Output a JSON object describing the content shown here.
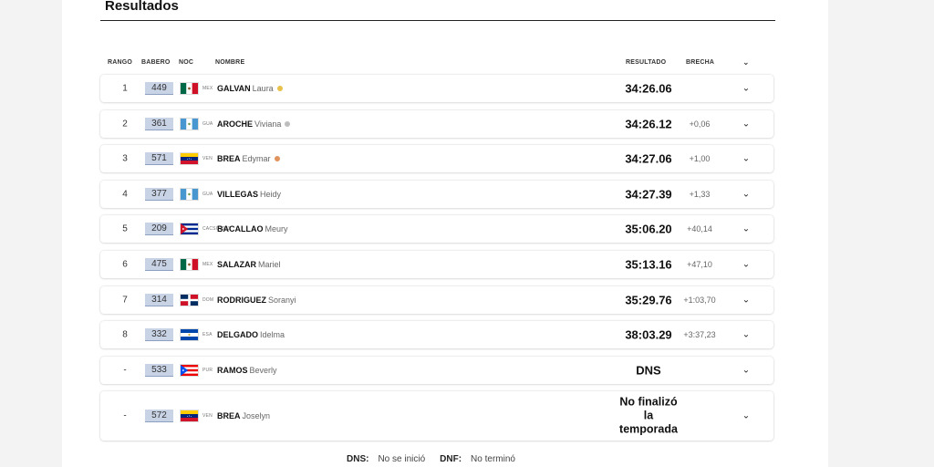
{
  "section": {
    "title": "Resultados"
  },
  "headers": {
    "rank": "RANGO",
    "bib": "BABERO",
    "noc": "NOC",
    "name": "NOMBRE",
    "result": "RESULTADO",
    "gap": "BRECHA",
    "expand": "⌄"
  },
  "colors": {
    "bib_bg": "#c9d3e6",
    "gold": "#e8c14b",
    "silver": "#bdbdbd",
    "bronze": "#e0935c"
  },
  "rows": [
    {
      "rank": "1",
      "bib": "449",
      "flag": "mexico-flag",
      "noc": "MEX",
      "last": "GALVAN",
      "first": "Laura",
      "medal": "gold",
      "result": "34:26.06",
      "gap": "",
      "chevron": "⌄"
    },
    {
      "rank": "2",
      "bib": "361",
      "flag": "guatemala-flag",
      "noc": "GUA",
      "last": "AROCHE",
      "first": "Viviana",
      "medal": "silver",
      "result": "34:26.12",
      "gap": "+0,06",
      "chevron": "⌄"
    },
    {
      "rank": "3",
      "bib": "571",
      "flag": "venezuela-flag",
      "noc": "VEN",
      "last": "BREA",
      "first": "Edymar",
      "medal": "bronze",
      "result": "34:27.06",
      "gap": "+1,00",
      "chevron": "⌄"
    },
    {
      "rank": "4",
      "bib": "377",
      "flag": "guatemala-flag",
      "noc": "GUA",
      "last": "VILLEGAS",
      "first": "Heidy",
      "medal": "",
      "result": "34:27.39",
      "gap": "+1,33",
      "chevron": "⌄"
    },
    {
      "rank": "5",
      "bib": "209",
      "flag": "cuba-flag",
      "noc": "CACSO2023",
      "last": "BACALLAO",
      "first": "Meury",
      "medal": "",
      "result": "35:06.20",
      "gap": "+40,14",
      "chevron": "⌄"
    },
    {
      "rank": "6",
      "bib": "475",
      "flag": "mexico-flag",
      "noc": "MEX",
      "last": "SALAZAR",
      "first": "Mariel",
      "medal": "",
      "result": "35:13.16",
      "gap": "+47,10",
      "chevron": "⌄"
    },
    {
      "rank": "7",
      "bib": "314",
      "flag": "dominican-flag",
      "noc": "DOM",
      "last": "RODRIGUEZ",
      "first": "Soranyi",
      "medal": "",
      "result": "35:29.76",
      "gap": "+1:03,70",
      "chevron": "⌄"
    },
    {
      "rank": "8",
      "bib": "332",
      "flag": "elsalvador-flag",
      "noc": "ESA",
      "last": "DELGADO",
      "first": "Idelma",
      "medal": "",
      "result": "38:03.29",
      "gap": "+3:37,23",
      "chevron": "⌄"
    },
    {
      "rank": "-",
      "bib": "533",
      "flag": "puertorico-flag",
      "noc": "PUR",
      "last": "RAMOS",
      "first": "Beverly",
      "medal": "",
      "result": "DNS",
      "gap": "",
      "chevron": "⌄"
    },
    {
      "rank": "-",
      "bib": "572",
      "flag": "venezuela-flag",
      "noc": "VEN",
      "last": "BREA",
      "first": "Joselyn",
      "medal": "",
      "result": "No finalizó la temporada",
      "gap": "",
      "chevron": "⌄",
      "tall": true
    }
  ],
  "legend": [
    {
      "key": "DNS:",
      "value": "No se inició"
    },
    {
      "key": "DNF:",
      "value": "No terminó"
    }
  ]
}
